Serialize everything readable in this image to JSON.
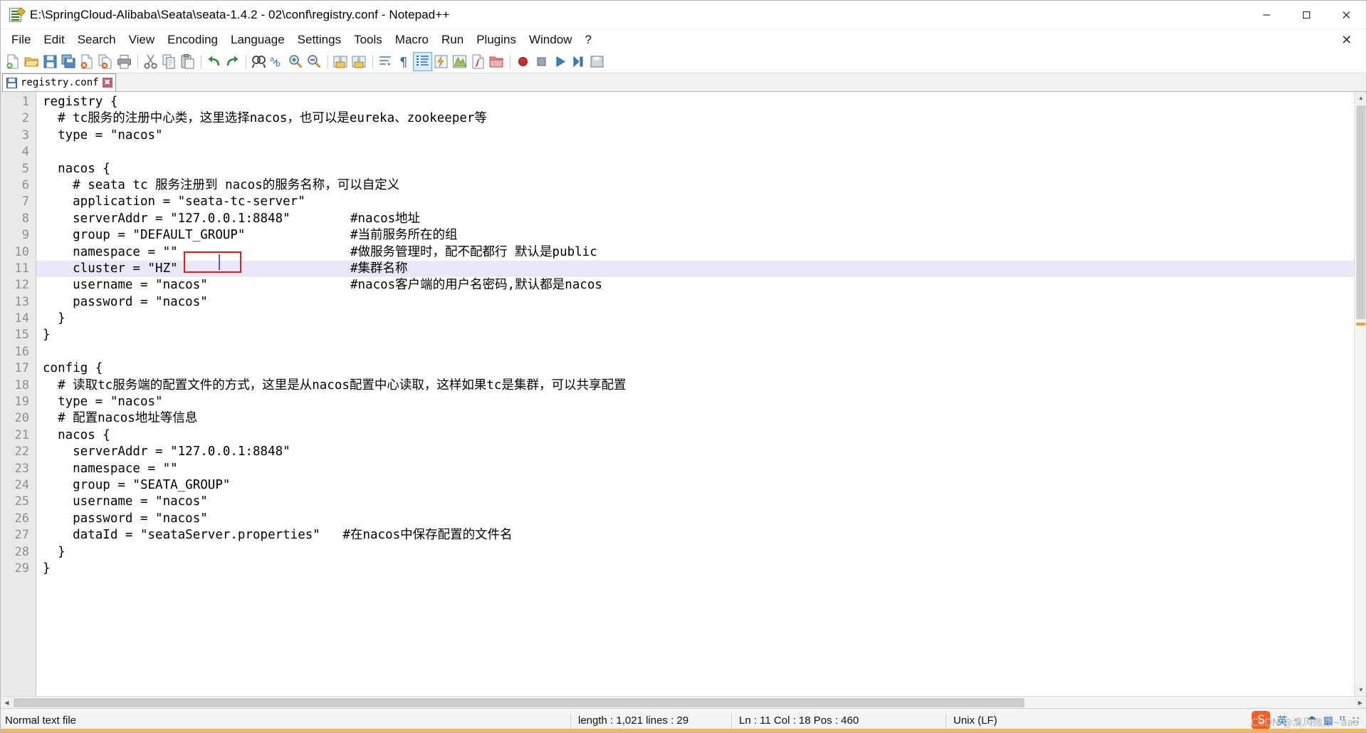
{
  "window": {
    "title": "E:\\SpringCloud-Alibaba\\Seata\\seata-1.4.2 - 02\\conf\\registry.conf - Notepad++",
    "app_icon": "notepad-plus-plus-icon",
    "minimize_label": "─",
    "maximize_label": "❐",
    "close_label": "✕"
  },
  "menubar": {
    "items": [
      {
        "label": "File",
        "name": "menu-file"
      },
      {
        "label": "Edit",
        "name": "menu-edit"
      },
      {
        "label": "Search",
        "name": "menu-search"
      },
      {
        "label": "View",
        "name": "menu-view"
      },
      {
        "label": "Encoding",
        "name": "menu-encoding"
      },
      {
        "label": "Language",
        "name": "menu-language"
      },
      {
        "label": "Settings",
        "name": "menu-settings"
      },
      {
        "label": "Tools",
        "name": "menu-tools"
      },
      {
        "label": "Macro",
        "name": "menu-macro"
      },
      {
        "label": "Run",
        "name": "menu-run"
      },
      {
        "label": "Plugins",
        "name": "menu-plugins"
      },
      {
        "label": "Window",
        "name": "menu-window"
      },
      {
        "label": "?",
        "name": "menu-help"
      }
    ],
    "close_document_label": "✕"
  },
  "toolbar": {
    "buttons": [
      "new-file-icon",
      "open-file-icon",
      "save-icon",
      "save-all-icon",
      "close-file-icon",
      "close-all-files-icon",
      "print-icon",
      "cut-icon",
      "copy-icon",
      "paste-icon",
      "undo-icon",
      "redo-icon",
      "find-icon",
      "replace-icon",
      "zoom-in-icon",
      "zoom-out-icon",
      "sync-vertical-scroll-icon",
      "sync-horizontal-scroll-icon",
      "word-wrap-icon",
      "show-all-characters-icon",
      "indent-guide-icon",
      "user-defined-language-icon",
      "document-map-icon",
      "function-list-icon",
      "folder-as-workspace-icon",
      "record-macro-icon",
      "stop-recording-icon",
      "playback-macro-icon",
      "run-macro-multiple-icon",
      "save-macro-icon"
    ]
  },
  "tabs": [
    {
      "label": "registry.conf",
      "icon": "saved-file-icon",
      "close_label": "✖",
      "active": true
    }
  ],
  "editor": {
    "highlight_line": 11,
    "annotation": {
      "type": "red-rectangle",
      "target_text": "\"HZ\"",
      "color": "#e01b1b"
    },
    "lines": [
      {
        "n": 1,
        "text": "registry {"
      },
      {
        "n": 2,
        "text": "  # tc服务的注册中心类，这里选择nacos，也可以是eureka、zookeeper等"
      },
      {
        "n": 3,
        "text": "  type = \"nacos\""
      },
      {
        "n": 4,
        "text": ""
      },
      {
        "n": 5,
        "text": "  nacos {"
      },
      {
        "n": 6,
        "text": "    # seata tc 服务注册到 nacos的服务名称，可以自定义"
      },
      {
        "n": 7,
        "text": "    application = \"seata-tc-server\""
      },
      {
        "n": 8,
        "text": "    serverAddr = \"127.0.0.1:8848\"        #nacos地址"
      },
      {
        "n": 9,
        "text": "    group = \"DEFAULT_GROUP\"              #当前服务所在的组"
      },
      {
        "n": 10,
        "text": "    namespace = \"\"                       #做服务管理时，配不配都行 默认是public"
      },
      {
        "n": 11,
        "text": "    cluster = \"HZ\"                       #集群名称"
      },
      {
        "n": 12,
        "text": "    username = \"nacos\"                   #nacos客户端的用户名密码,默认都是nacos"
      },
      {
        "n": 13,
        "text": "    password = \"nacos\""
      },
      {
        "n": 14,
        "text": "  }"
      },
      {
        "n": 15,
        "text": "}"
      },
      {
        "n": 16,
        "text": ""
      },
      {
        "n": 17,
        "text": "config {"
      },
      {
        "n": 18,
        "text": "  # 读取tc服务端的配置文件的方式，这里是从nacos配置中心读取，这样如果tc是集群，可以共享配置"
      },
      {
        "n": 19,
        "text": "  type = \"nacos\""
      },
      {
        "n": 20,
        "text": "  # 配置nacos地址等信息"
      },
      {
        "n": 21,
        "text": "  nacos {"
      },
      {
        "n": 22,
        "text": "    serverAddr = \"127.0.0.1:8848\""
      },
      {
        "n": 23,
        "text": "    namespace = \"\""
      },
      {
        "n": 24,
        "text": "    group = \"SEATA_GROUP\""
      },
      {
        "n": 25,
        "text": "    username = \"nacos\""
      },
      {
        "n": 26,
        "text": "    password = \"nacos\""
      },
      {
        "n": 27,
        "text": "    dataId = \"seataServer.properties\"   #在nacos中保存配置的文件名"
      },
      {
        "n": 28,
        "text": "  }"
      },
      {
        "n": 29,
        "text": "}"
      }
    ]
  },
  "statusbar": {
    "doc_type": "Normal text file",
    "length_lines": "length : 1,021   lines : 29",
    "position": "Ln : 11   Col : 18   Pos : 460",
    "eol": "Unix (LF)"
  },
  "ime": {
    "logo": "S",
    "items": [
      "英",
      "·,",
      "☂",
      "▦",
      "ᵗᵗ",
      "∷"
    ]
  },
  "watermark": "CSDN @清风微凉~aaa"
}
